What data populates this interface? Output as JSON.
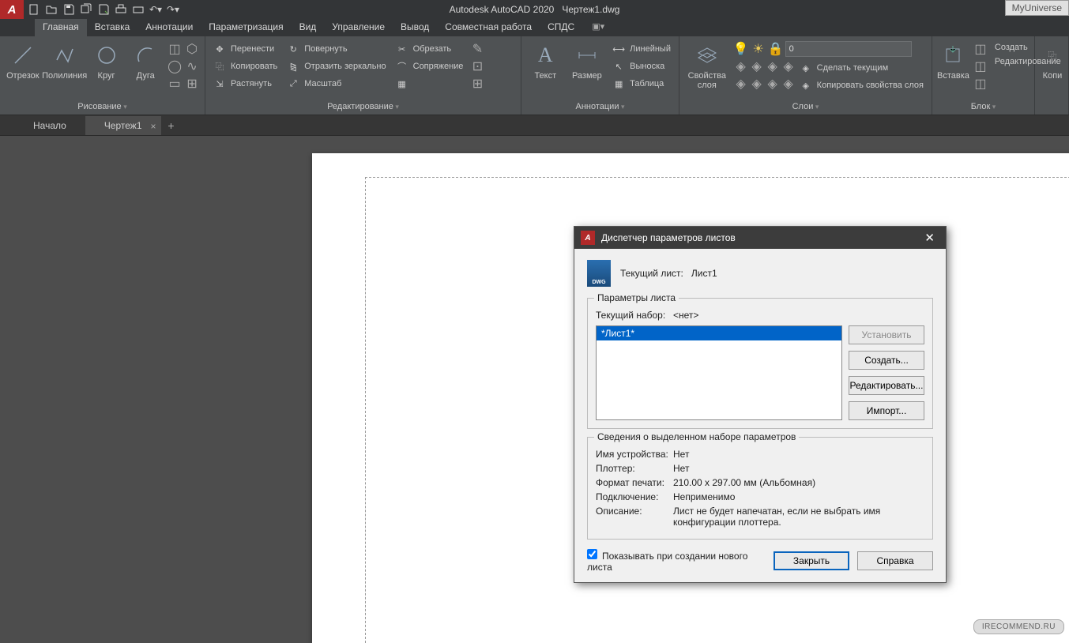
{
  "app": {
    "title": "Autodesk AutoCAD 2020",
    "doc": "Чертеж1.dwg",
    "watermark": "MyUniverse"
  },
  "menu": [
    "Главная",
    "Вставка",
    "Аннотации",
    "Параметризация",
    "Вид",
    "Управление",
    "Вывод",
    "Совместная работа",
    "СПДС"
  ],
  "ribbon": {
    "draw": {
      "title": "Рисование",
      "items": [
        "Отрезок",
        "Полилиния",
        "Круг",
        "Дуга"
      ]
    },
    "edit": {
      "title": "Редактирование",
      "rows": [
        [
          "Перенести",
          "Повернуть",
          "Обрезать"
        ],
        [
          "Копировать",
          "Отразить зеркально",
          "Сопряжение"
        ],
        [
          "Растянуть",
          "Масштаб"
        ]
      ]
    },
    "annot": {
      "title": "Аннотации",
      "big": [
        "Текст",
        "Размер"
      ],
      "rows": [
        "Линейный",
        "Выноска",
        "Таблица"
      ]
    },
    "layers": {
      "title": "Слои",
      "props": "Свойства\nслоя",
      "combo": "0",
      "rows": [
        "Сделать текущим",
        "Копировать свойства слоя"
      ]
    },
    "block": {
      "title": "Блок",
      "big": "Вставка",
      "rows": [
        "Создать",
        "Редактирование"
      ]
    },
    "last": "Копи"
  },
  "tabs": {
    "start": "Начало",
    "file": "Чертеж1"
  },
  "dialog": {
    "title": "Диспетчер параметров листов",
    "current_label": "Текущий лист:",
    "current_value": "Лист1",
    "grp1": "Параметры листа",
    "set_label": "Текущий набор:",
    "set_value": "<нет>",
    "list_item": "*Лист1*",
    "btn_set": "Установить",
    "btn_new": "Создать...",
    "btn_edit": "Редактировать...",
    "btn_import": "Импорт...",
    "grp2": "Сведения о выделенном наборе параметров",
    "info": [
      [
        "Имя устройства:",
        "Нет"
      ],
      [
        "Плоттер:",
        "Нет"
      ],
      [
        "Формат печати:",
        "210.00 x 297.00 мм (Альбомная)"
      ],
      [
        "Подключение:",
        "Неприменимо"
      ],
      [
        "Описание:",
        "Лист не будет напечатан, если не выбрать имя конфигурации плоттера."
      ]
    ],
    "chk": "Показывать при создании нового листа",
    "btn_close": "Закрыть",
    "btn_help": "Справка"
  },
  "badge": "IRECOMMEND.RU"
}
